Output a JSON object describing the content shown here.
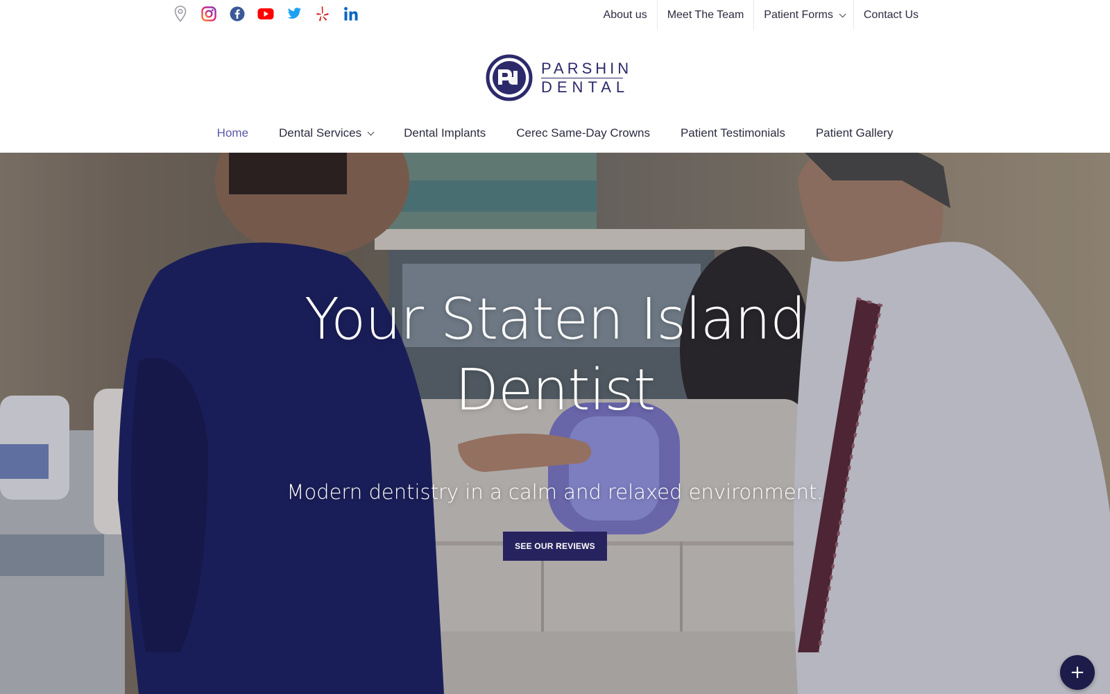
{
  "social": [
    {
      "name": "map-pin-icon",
      "color": "#9a9aa6"
    },
    {
      "name": "instagram-icon",
      "color": "#c13584"
    },
    {
      "name": "facebook-icon",
      "color": "#3b5998"
    },
    {
      "name": "youtube-icon",
      "color": "#ff0000"
    },
    {
      "name": "twitter-icon",
      "color": "#1da1f2"
    },
    {
      "name": "yelp-icon",
      "color": "#d32323"
    },
    {
      "name": "linkedin-icon",
      "color": "#0a66c2"
    }
  ],
  "top_nav": {
    "about": "About us",
    "team": "Meet The Team",
    "forms": "Patient Forms",
    "contact": "Contact Us"
  },
  "logo": {
    "line1": "PARSHIN",
    "line2": "DENTAL",
    "color": "#2c2a6b"
  },
  "main_nav": {
    "home": "Home",
    "services": "Dental Services",
    "implants": "Dental Implants",
    "cerec": "Cerec Same-Day Crowns",
    "testimonials": "Patient Testimonials",
    "gallery": "Patient Gallery",
    "active_color": "#5a57a6"
  },
  "hero": {
    "title_line1": "Your Staten Island",
    "title_line2": "Dentist",
    "subtitle": "Modern dentistry in a calm and relaxed environment.",
    "button": "SEE OUR REVIEWS",
    "button_color": "#27235f"
  },
  "fab": {
    "label": "+",
    "icon": "plus-icon"
  }
}
